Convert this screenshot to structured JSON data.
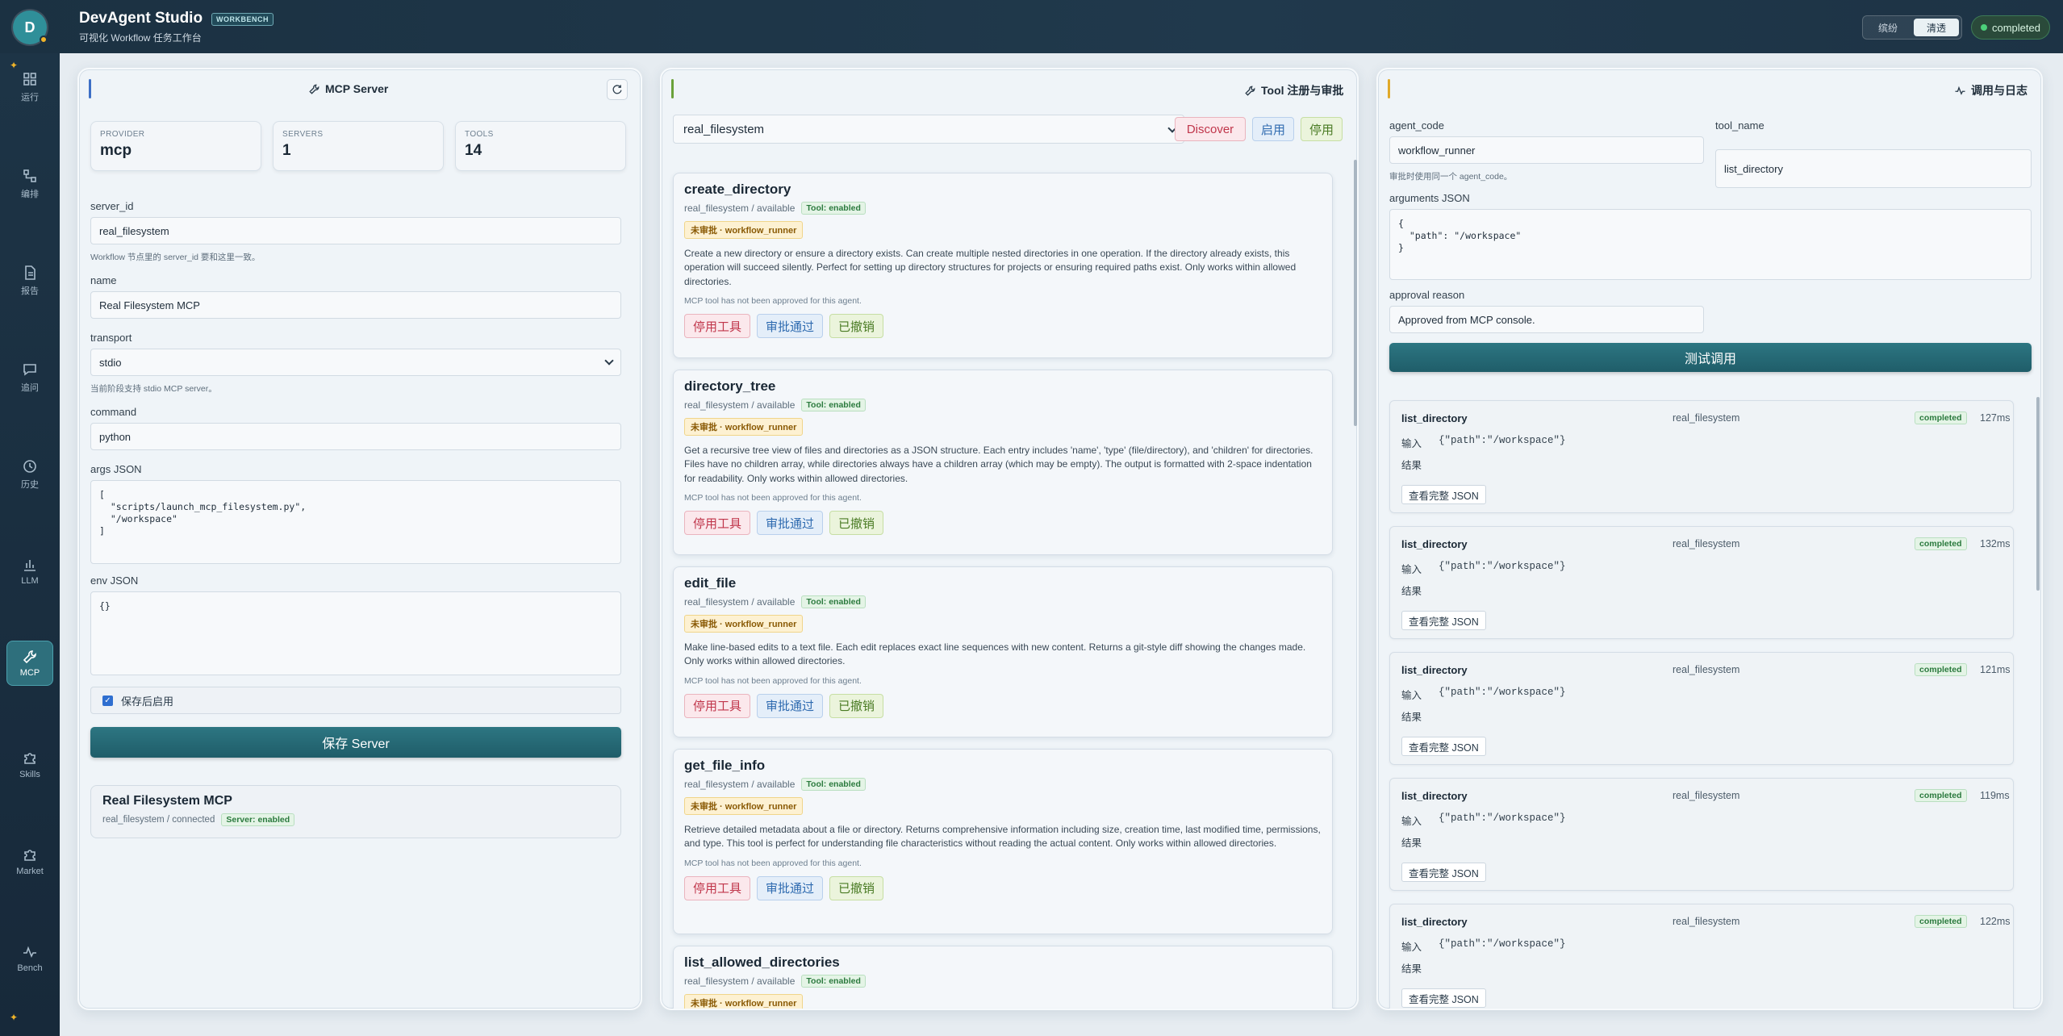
{
  "app": {
    "logo_letter": "D",
    "title": "DevAgent Studio",
    "badge": "WORKBENCH",
    "subtitle": "可视化 Workflow 任务工作台",
    "mode_left": "缤纷",
    "mode_right": "清透",
    "status": "completed"
  },
  "nav": [
    {
      "label": "运行",
      "icon": "grid-icon"
    },
    {
      "label": "编排",
      "icon": "workflow-icon"
    },
    {
      "label": "报告",
      "icon": "report-icon"
    },
    {
      "label": "追问",
      "icon": "chat-icon"
    },
    {
      "label": "历史",
      "icon": "history-icon"
    },
    {
      "label": "LLM",
      "icon": "bar-chart-icon"
    },
    {
      "label": "MCP",
      "icon": "wrench-icon",
      "active": true
    },
    {
      "label": "Skills",
      "icon": "puzzle-icon"
    },
    {
      "label": "Market",
      "icon": "puzzle-icon"
    },
    {
      "label": "Bench",
      "icon": "pulse-icon"
    }
  ],
  "server_panel": {
    "title": "MCP Server",
    "stats": [
      {
        "key": "PROVIDER",
        "value": "mcp"
      },
      {
        "key": "SERVERS",
        "value": "1"
      },
      {
        "key": "TOOLS",
        "value": "14"
      }
    ],
    "server_id_label": "server_id",
    "server_id_value": "real_filesystem",
    "server_id_hint": "Workflow 节点里的 server_id 要和这里一致。",
    "name_label": "name",
    "name_value": "Real Filesystem MCP",
    "transport_label": "transport",
    "transport_value": "stdio",
    "transport_hint": "当前阶段支持 stdio MCP server。",
    "command_label": "command",
    "command_value": "python",
    "args_label": "args JSON",
    "args_value": "[\n  \"scripts/launch_mcp_filesystem.py\",\n  \"/workspace\"\n]",
    "env_label": "env JSON",
    "env_value": "{}",
    "enable_after_save": "保存后启用",
    "save_button": "保存 Server",
    "server_card_title": "Real Filesystem MCP",
    "server_card_sub": "real_filesystem / connected",
    "server_card_tag": "Server: enabled"
  },
  "tool_panel": {
    "title": "Tool 注册与审批",
    "selected_server": "real_filesystem",
    "discover": "Discover",
    "enable": "启用",
    "disable": "停用",
    "tools": [
      {
        "name": "create_directory",
        "meta": "real_filesystem / available",
        "tag": "Tool: enabled",
        "approval": "未审批 · workflow_runner",
        "desc": "Create a new directory or ensure a directory exists. Can create multiple nested directories in one operation. If the directory already exists, this operation will succeed silently. Perfect for setting up directory structures for projects or ensuring required paths exist. Only works within allowed directories.",
        "note": "MCP tool has not been approved for this agent.",
        "btn_disable": "停用工具",
        "btn_approve": "审批通过",
        "btn_revoked": "已撤销"
      },
      {
        "name": "directory_tree",
        "meta": "real_filesystem / available",
        "tag": "Tool: enabled",
        "approval": "未审批 · workflow_runner",
        "desc": "Get a recursive tree view of files and directories as a JSON structure. Each entry includes 'name', 'type' (file/directory), and 'children' for directories. Files have no children array, while directories always have a children array (which may be empty). The output is formatted with 2-space indentation for readability. Only works within allowed directories.",
        "note": "MCP tool has not been approved for this agent.",
        "btn_disable": "停用工具",
        "btn_approve": "审批通过",
        "btn_revoked": "已撤销"
      },
      {
        "name": "edit_file",
        "meta": "real_filesystem / available",
        "tag": "Tool: enabled",
        "approval": "未审批 · workflow_runner",
        "desc": "Make line-based edits to a text file. Each edit replaces exact line sequences with new content. Returns a git-style diff showing the changes made. Only works within allowed directories.",
        "note": "MCP tool has not been approved for this agent.",
        "btn_disable": "停用工具",
        "btn_approve": "审批通过",
        "btn_revoked": "已撤销"
      },
      {
        "name": "get_file_info",
        "meta": "real_filesystem / available",
        "tag": "Tool: enabled",
        "approval": "未审批 · workflow_runner",
        "desc": "Retrieve detailed metadata about a file or directory. Returns comprehensive information including size, creation time, last modified time, permissions, and type. This tool is perfect for understanding file characteristics without reading the actual content. Only works within allowed directories.",
        "note": "MCP tool has not been approved for this agent.",
        "btn_disable": "停用工具",
        "btn_approve": "审批通过",
        "btn_revoked": "已撤销"
      },
      {
        "name": "list_allowed_directories",
        "meta": "real_filesystem / available",
        "tag": "Tool: enabled",
        "approval": "未审批 · workflow_runner",
        "desc": "",
        "note": "",
        "btn_disable": "",
        "btn_approve": "",
        "btn_revoked": ""
      }
    ]
  },
  "call_panel": {
    "title": "调用与日志",
    "agent_code_label": "agent_code",
    "agent_code_value": "workflow_runner",
    "agent_code_hint": "审批时使用同一个 agent_code。",
    "tool_name_label": "tool_name",
    "tool_name_value": "list_directory",
    "arguments_label": "arguments JSON",
    "arguments_value": "{\n  \"path\": \"/workspace\"\n}",
    "approval_reason_label": "approval reason",
    "approval_reason_value": "Approved from MCP console.",
    "test_button": "测试调用",
    "logs": [
      {
        "tool": "list_directory",
        "server": "real_filesystem",
        "status": "completed",
        "ms": "127ms",
        "input_label": "输入",
        "input": "{\"path\":\"/workspace\"}",
        "result_label": "结果",
        "view": "查看完整 JSON"
      },
      {
        "tool": "list_directory",
        "server": "real_filesystem",
        "status": "completed",
        "ms": "132ms",
        "input_label": "输入",
        "input": "{\"path\":\"/workspace\"}",
        "result_label": "结果",
        "view": "查看完整 JSON"
      },
      {
        "tool": "list_directory",
        "server": "real_filesystem",
        "status": "completed",
        "ms": "121ms",
        "input_label": "输入",
        "input": "{\"path\":\"/workspace\"}",
        "result_label": "结果",
        "view": "查看完整 JSON"
      },
      {
        "tool": "list_directory",
        "server": "real_filesystem",
        "status": "completed",
        "ms": "119ms",
        "input_label": "输入",
        "input": "{\"path\":\"/workspace\"}",
        "result_label": "结果",
        "view": "查看完整 JSON"
      },
      {
        "tool": "list_directory",
        "server": "real_filesystem",
        "status": "completed",
        "ms": "122ms",
        "input_label": "输入",
        "input": "{\"path\":\"/workspace\"}",
        "result_label": "结果",
        "view": "查看完整 JSON"
      }
    ]
  },
  "colors": {
    "accent": "#2d7682",
    "status_green": "#2b7a3e",
    "approval_amber": "#8a5a05",
    "danger": "#c0364b"
  }
}
